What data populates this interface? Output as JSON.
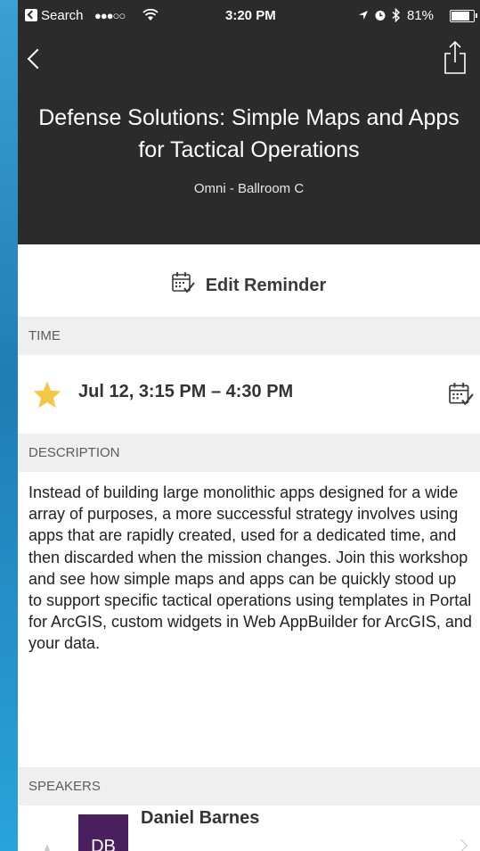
{
  "status_bar": {
    "back_app": "Search",
    "signal": "●●●○○",
    "time": "3:20 PM",
    "battery": "81%"
  },
  "header": {
    "title": "Defense Solutions: Simple Maps and Apps for Tactical Operations",
    "location": "Omni - Ballroom C"
  },
  "reminder": {
    "label": "Edit Reminder"
  },
  "time_section": {
    "header": "TIME",
    "value": "Jul 12, 3:15 PM – 4:30 PM",
    "favorited": true
  },
  "description_section": {
    "header": "DESCRIPTION",
    "text": "Instead of building large monolithic apps designed for a wide array of purposes, a more successful strategy involves using apps that are rapidly created, used for a dedicated time, and then discarded when the mission changes. Join this workshop and see how simple maps and apps can be quickly stood up to support specific tactical operations using templates in Portal for ArcGIS, custom widgets in Web AppBuilder for ArcGIS, and your data."
  },
  "speakers_section": {
    "header": "SPEAKERS",
    "speakers": [
      {
        "initials": "DB",
        "name": "Daniel Barnes",
        "favorited": false
      }
    ]
  },
  "colors": {
    "header_bg": "#2b2b2b",
    "star_active": "#f6c744",
    "star_inactive": "#c8c8c8",
    "avatar_bg": "#4a1f5e",
    "section_bg": "#efefef"
  }
}
